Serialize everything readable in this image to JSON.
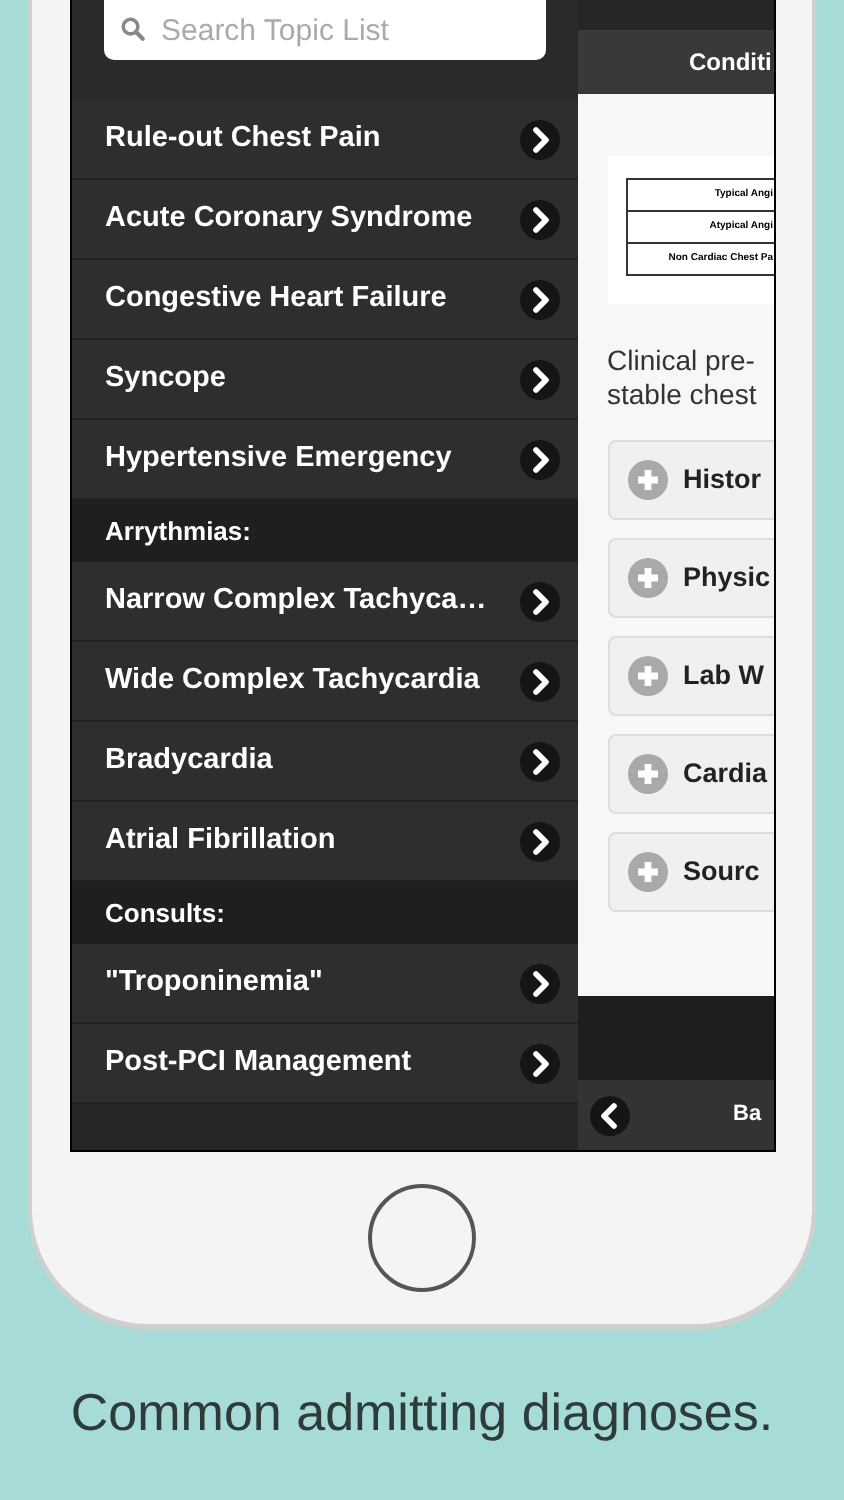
{
  "search": {
    "placeholder": "Search Topic List"
  },
  "menu": [
    {
      "kind": "item",
      "label": "Rule-out Chest Pain"
    },
    {
      "kind": "item",
      "label": "Acute Coronary Syndrome"
    },
    {
      "kind": "item",
      "label": "Congestive Heart Failure"
    },
    {
      "kind": "item",
      "label": "Syncope"
    },
    {
      "kind": "item",
      "label": "Hypertensive Emergency"
    },
    {
      "kind": "header",
      "label": "Arrythmias:"
    },
    {
      "kind": "item",
      "label": "Narrow Complex Tachyca…"
    },
    {
      "kind": "item",
      "label": "Wide Complex Tachycardia"
    },
    {
      "kind": "item",
      "label": "Bradycardia"
    },
    {
      "kind": "item",
      "label": "Atrial Fibrillation"
    },
    {
      "kind": "header",
      "label": "Consults:"
    },
    {
      "kind": "item",
      "label": "\"Troponinemia\""
    },
    {
      "kind": "item",
      "label": "Post-PCI Management"
    }
  ],
  "detail": {
    "title": "Conditi",
    "table_rows": [
      "Typical Angi",
      "Atypical Angi",
      "Non Cardiac Chest Pa"
    ],
    "text_lines": [
      "Clinical pre-",
      "stable chest"
    ],
    "sections": [
      "Histor",
      "Physic",
      "Lab W",
      "Cardia",
      "Sourc"
    ],
    "back_label": "Ba"
  },
  "caption": "Common admitting diagnoses."
}
